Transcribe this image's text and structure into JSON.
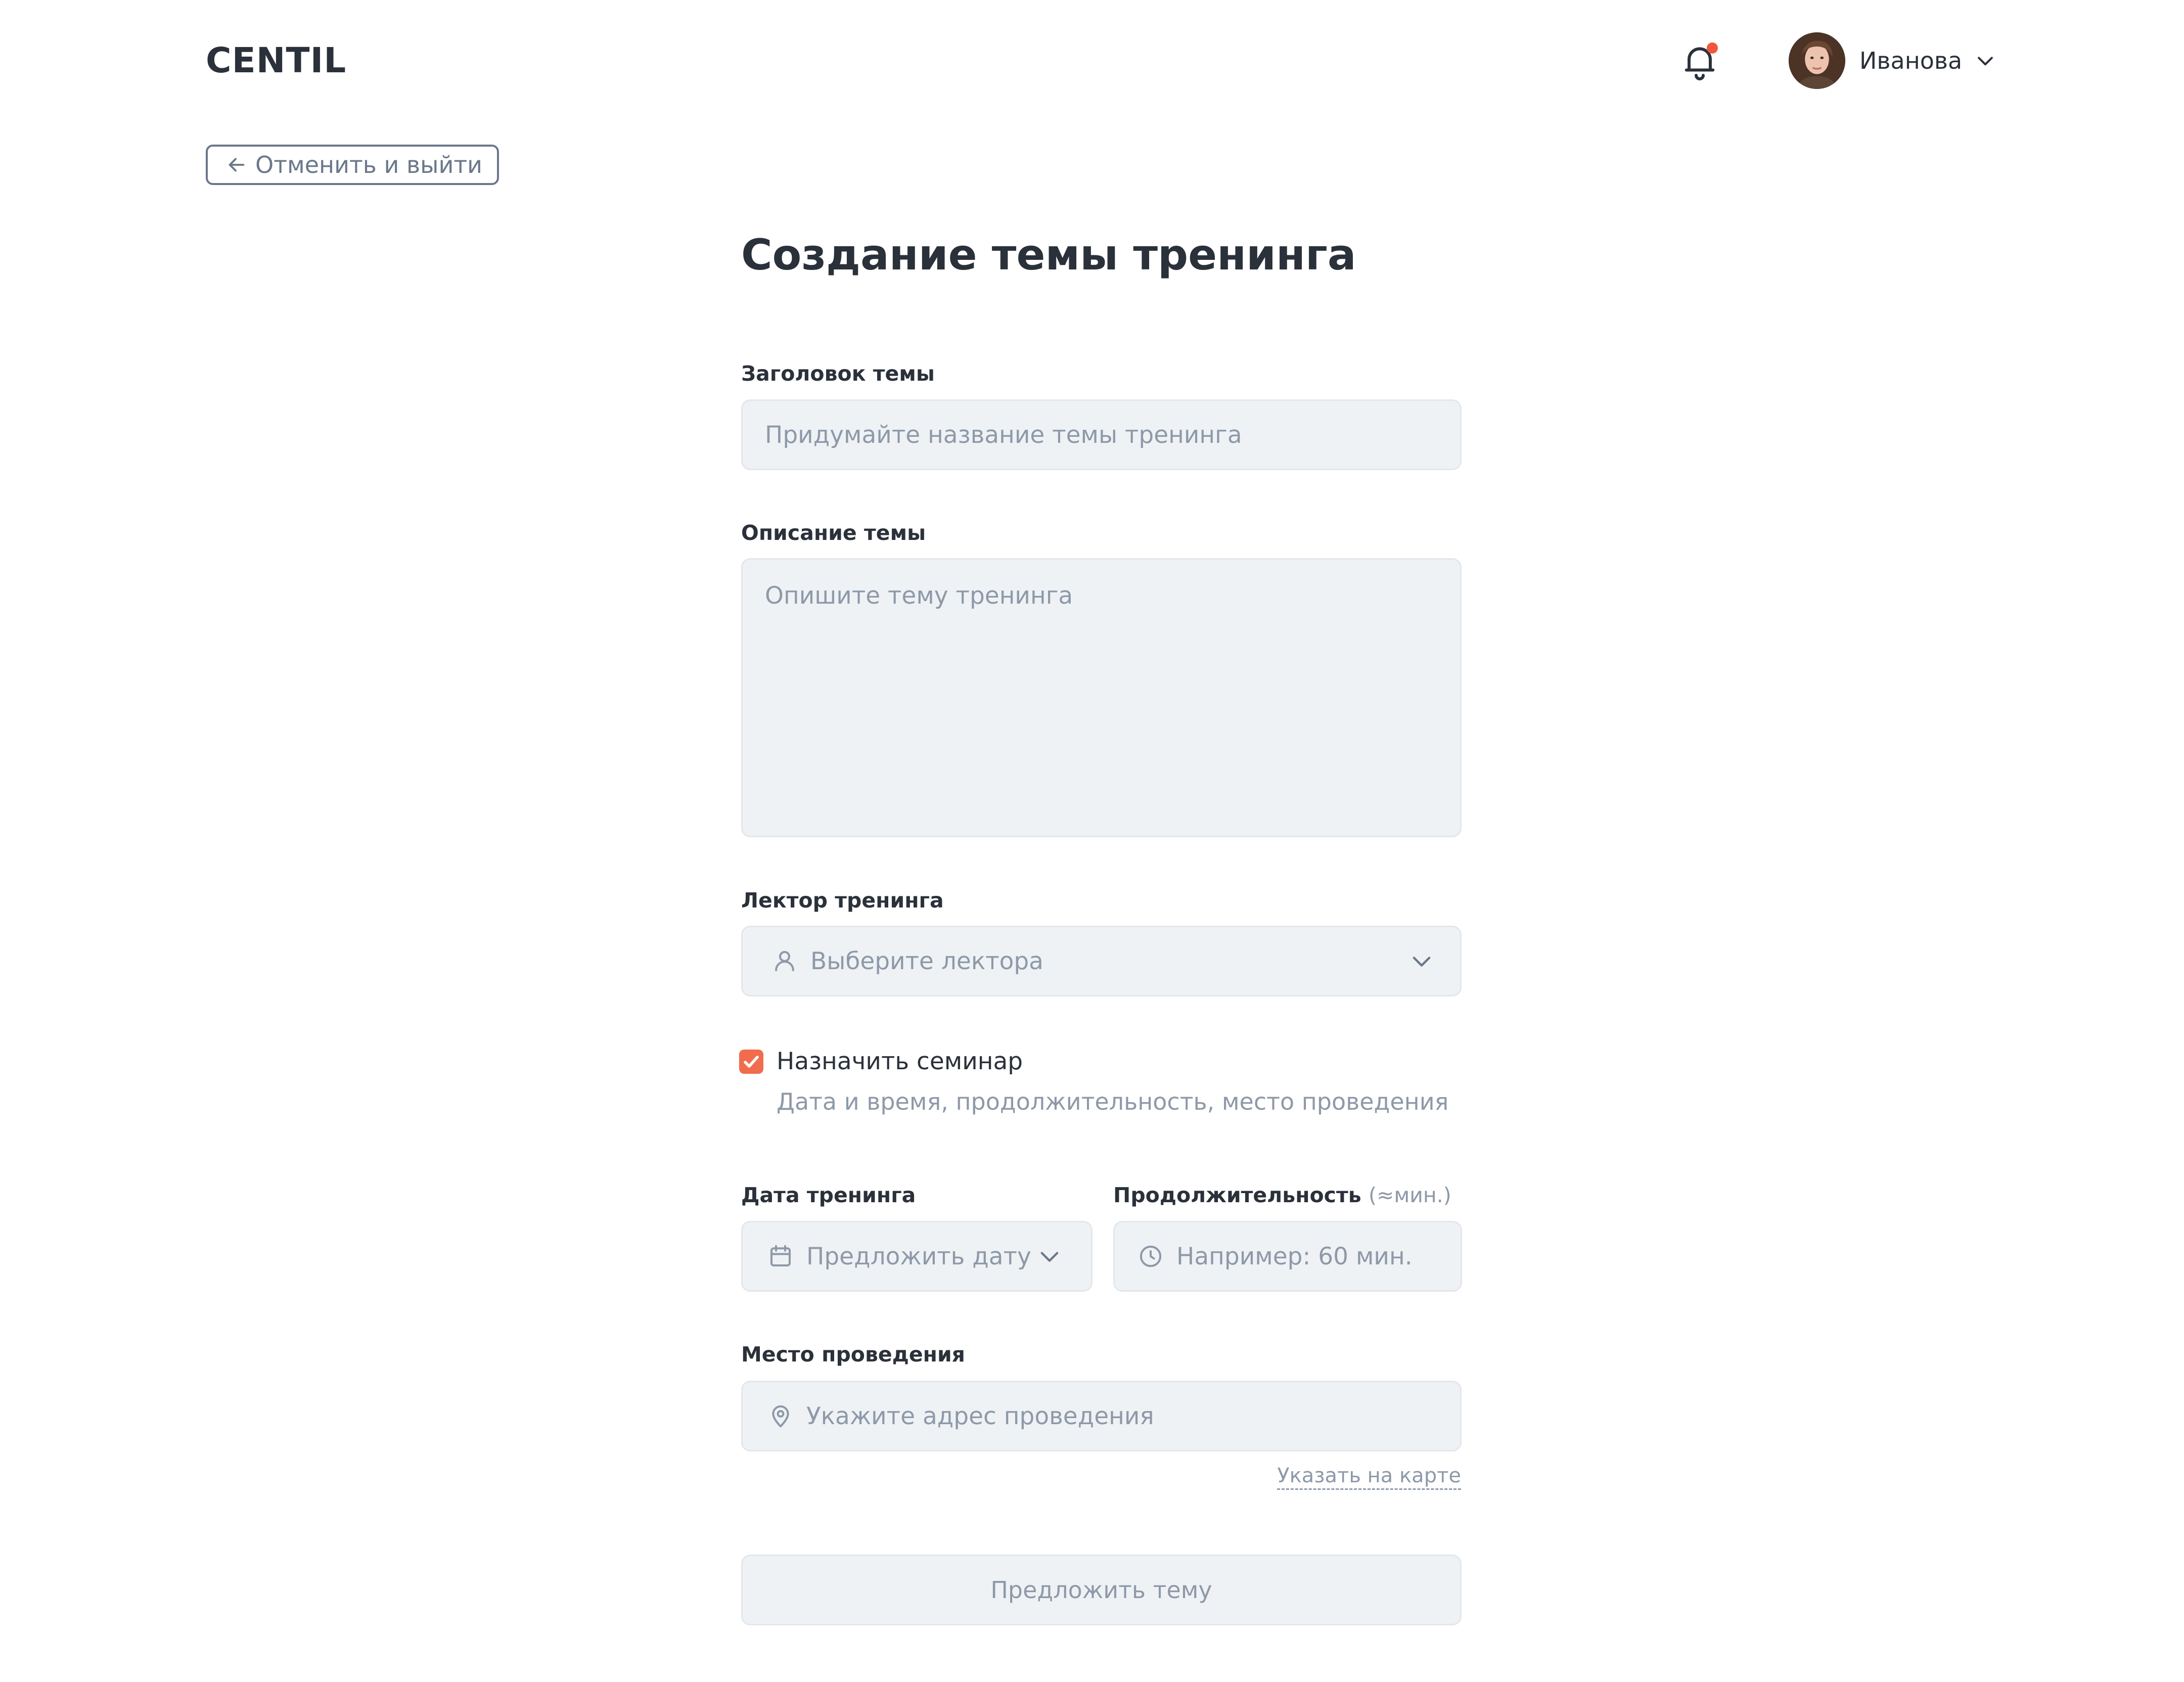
{
  "header": {
    "logo": "CENTIL",
    "user_name": "Иванова"
  },
  "back_button": {
    "label": "Отменить и выйти"
  },
  "form": {
    "title": "Создание темы тренинга",
    "topic_title": {
      "label": "Заголовок темы",
      "placeholder": "Придумайте название темы тренинга"
    },
    "description": {
      "label": "Описание темы",
      "placeholder": "Опишите тему тренинга"
    },
    "lecturer": {
      "label": "Лектор тренинга",
      "placeholder": "Выберите лектора"
    },
    "seminar": {
      "label": "Назначить семинар",
      "hint": "Дата и время, продолжительность, место проведения",
      "checked": true
    },
    "date": {
      "label": "Дата тренинга",
      "placeholder": "Предложить дату"
    },
    "duration": {
      "label": "Продолжительность",
      "label_suffix": "(≈мин.)",
      "placeholder": "Например: 60 мин."
    },
    "location": {
      "label": "Место проведения",
      "placeholder": "Укажите адрес проведения",
      "map_link": "Указать на карте"
    },
    "submit_label": "Предложить тему"
  },
  "colors": {
    "accent": "#f06c4d",
    "notification_dot": "#f0573c",
    "input_bg": "#eff2f5",
    "placeholder": "#8e99a8",
    "text": "#2b313a"
  },
  "icons": {
    "bell": "bell-icon",
    "user_chevron": "chevron-down-icon",
    "back": "arrow-left-icon",
    "lecturer": "user-icon",
    "date": "calendar-icon",
    "duration": "clock-icon",
    "location": "map-pin-icon",
    "checkbox": "check-icon"
  }
}
